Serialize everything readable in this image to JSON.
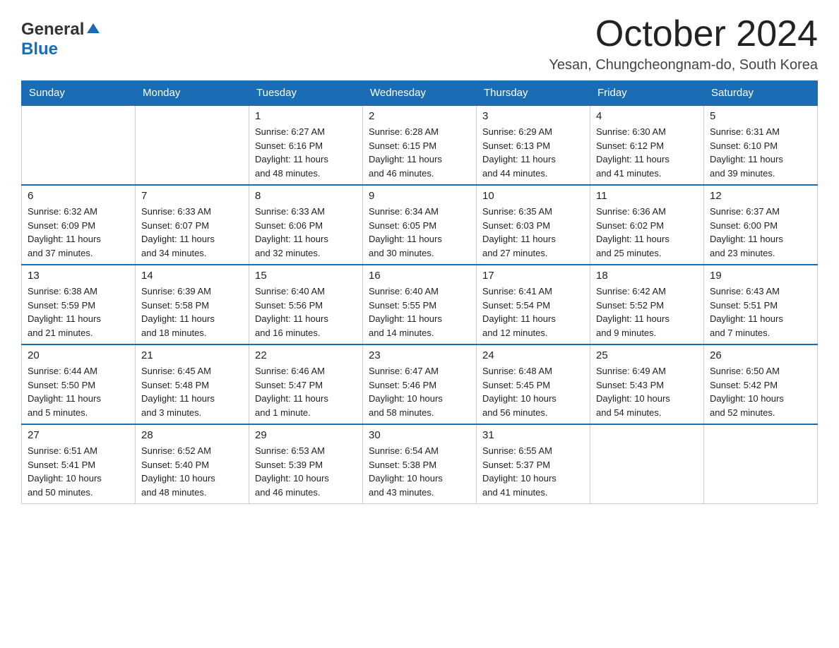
{
  "logo": {
    "general": "General",
    "blue": "Blue"
  },
  "header": {
    "month": "October 2024",
    "location": "Yesan, Chungcheongnam-do, South Korea"
  },
  "weekdays": [
    "Sunday",
    "Monday",
    "Tuesday",
    "Wednesday",
    "Thursday",
    "Friday",
    "Saturday"
  ],
  "weeks": [
    [
      {
        "day": "",
        "info": ""
      },
      {
        "day": "",
        "info": ""
      },
      {
        "day": "1",
        "info": "Sunrise: 6:27 AM\nSunset: 6:16 PM\nDaylight: 11 hours\nand 48 minutes."
      },
      {
        "day": "2",
        "info": "Sunrise: 6:28 AM\nSunset: 6:15 PM\nDaylight: 11 hours\nand 46 minutes."
      },
      {
        "day": "3",
        "info": "Sunrise: 6:29 AM\nSunset: 6:13 PM\nDaylight: 11 hours\nand 44 minutes."
      },
      {
        "day": "4",
        "info": "Sunrise: 6:30 AM\nSunset: 6:12 PM\nDaylight: 11 hours\nand 41 minutes."
      },
      {
        "day": "5",
        "info": "Sunrise: 6:31 AM\nSunset: 6:10 PM\nDaylight: 11 hours\nand 39 minutes."
      }
    ],
    [
      {
        "day": "6",
        "info": "Sunrise: 6:32 AM\nSunset: 6:09 PM\nDaylight: 11 hours\nand 37 minutes."
      },
      {
        "day": "7",
        "info": "Sunrise: 6:33 AM\nSunset: 6:07 PM\nDaylight: 11 hours\nand 34 minutes."
      },
      {
        "day": "8",
        "info": "Sunrise: 6:33 AM\nSunset: 6:06 PM\nDaylight: 11 hours\nand 32 minutes."
      },
      {
        "day": "9",
        "info": "Sunrise: 6:34 AM\nSunset: 6:05 PM\nDaylight: 11 hours\nand 30 minutes."
      },
      {
        "day": "10",
        "info": "Sunrise: 6:35 AM\nSunset: 6:03 PM\nDaylight: 11 hours\nand 27 minutes."
      },
      {
        "day": "11",
        "info": "Sunrise: 6:36 AM\nSunset: 6:02 PM\nDaylight: 11 hours\nand 25 minutes."
      },
      {
        "day": "12",
        "info": "Sunrise: 6:37 AM\nSunset: 6:00 PM\nDaylight: 11 hours\nand 23 minutes."
      }
    ],
    [
      {
        "day": "13",
        "info": "Sunrise: 6:38 AM\nSunset: 5:59 PM\nDaylight: 11 hours\nand 21 minutes."
      },
      {
        "day": "14",
        "info": "Sunrise: 6:39 AM\nSunset: 5:58 PM\nDaylight: 11 hours\nand 18 minutes."
      },
      {
        "day": "15",
        "info": "Sunrise: 6:40 AM\nSunset: 5:56 PM\nDaylight: 11 hours\nand 16 minutes."
      },
      {
        "day": "16",
        "info": "Sunrise: 6:40 AM\nSunset: 5:55 PM\nDaylight: 11 hours\nand 14 minutes."
      },
      {
        "day": "17",
        "info": "Sunrise: 6:41 AM\nSunset: 5:54 PM\nDaylight: 11 hours\nand 12 minutes."
      },
      {
        "day": "18",
        "info": "Sunrise: 6:42 AM\nSunset: 5:52 PM\nDaylight: 11 hours\nand 9 minutes."
      },
      {
        "day": "19",
        "info": "Sunrise: 6:43 AM\nSunset: 5:51 PM\nDaylight: 11 hours\nand 7 minutes."
      }
    ],
    [
      {
        "day": "20",
        "info": "Sunrise: 6:44 AM\nSunset: 5:50 PM\nDaylight: 11 hours\nand 5 minutes."
      },
      {
        "day": "21",
        "info": "Sunrise: 6:45 AM\nSunset: 5:48 PM\nDaylight: 11 hours\nand 3 minutes."
      },
      {
        "day": "22",
        "info": "Sunrise: 6:46 AM\nSunset: 5:47 PM\nDaylight: 11 hours\nand 1 minute."
      },
      {
        "day": "23",
        "info": "Sunrise: 6:47 AM\nSunset: 5:46 PM\nDaylight: 10 hours\nand 58 minutes."
      },
      {
        "day": "24",
        "info": "Sunrise: 6:48 AM\nSunset: 5:45 PM\nDaylight: 10 hours\nand 56 minutes."
      },
      {
        "day": "25",
        "info": "Sunrise: 6:49 AM\nSunset: 5:43 PM\nDaylight: 10 hours\nand 54 minutes."
      },
      {
        "day": "26",
        "info": "Sunrise: 6:50 AM\nSunset: 5:42 PM\nDaylight: 10 hours\nand 52 minutes."
      }
    ],
    [
      {
        "day": "27",
        "info": "Sunrise: 6:51 AM\nSunset: 5:41 PM\nDaylight: 10 hours\nand 50 minutes."
      },
      {
        "day": "28",
        "info": "Sunrise: 6:52 AM\nSunset: 5:40 PM\nDaylight: 10 hours\nand 48 minutes."
      },
      {
        "day": "29",
        "info": "Sunrise: 6:53 AM\nSunset: 5:39 PM\nDaylight: 10 hours\nand 46 minutes."
      },
      {
        "day": "30",
        "info": "Sunrise: 6:54 AM\nSunset: 5:38 PM\nDaylight: 10 hours\nand 43 minutes."
      },
      {
        "day": "31",
        "info": "Sunrise: 6:55 AM\nSunset: 5:37 PM\nDaylight: 10 hours\nand 41 minutes."
      },
      {
        "day": "",
        "info": ""
      },
      {
        "day": "",
        "info": ""
      }
    ]
  ]
}
